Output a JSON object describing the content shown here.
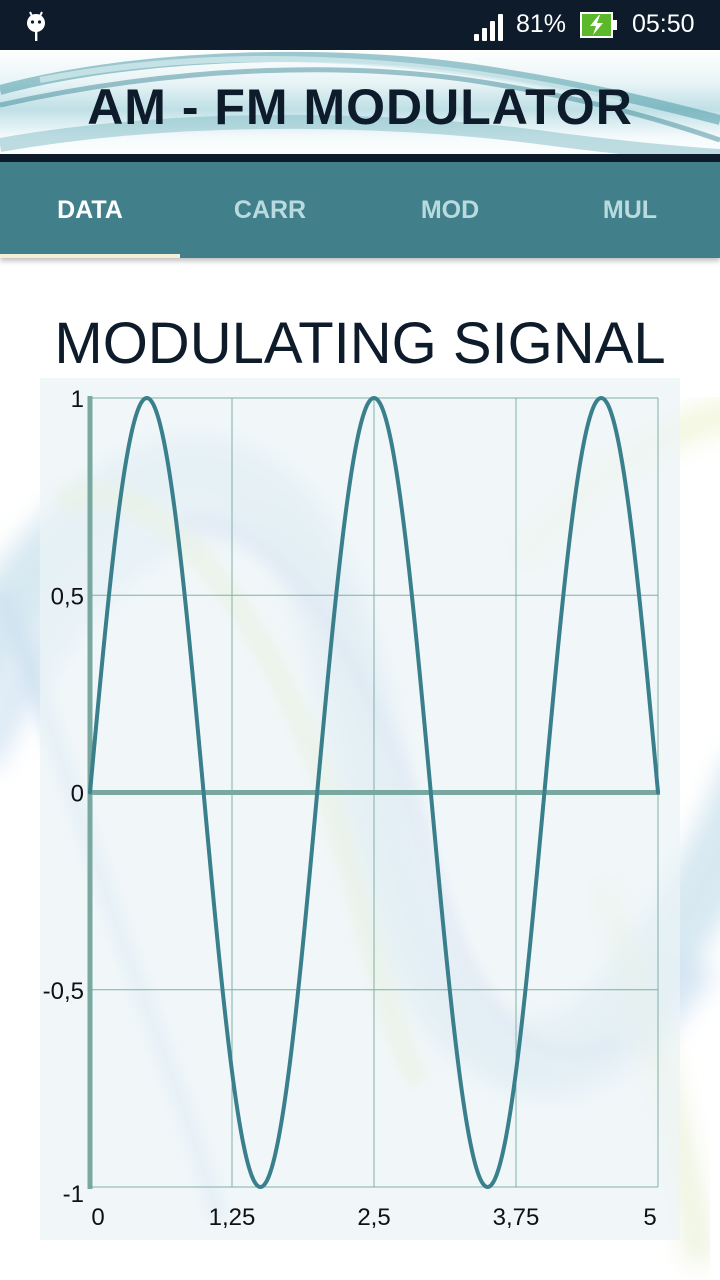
{
  "status_bar": {
    "notification_icon": "android-debug-icon",
    "signal_icon": "cell-signal-icon",
    "battery_percent": "81%",
    "battery_icon": "battery-charging-icon",
    "time": "05:50"
  },
  "banner": {
    "title": "AM - FM MODULATOR"
  },
  "tabs": [
    {
      "label": "DATA",
      "active": true
    },
    {
      "label": "CARR",
      "active": false
    },
    {
      "label": "MOD",
      "active": false
    },
    {
      "label": "MUL",
      "active": false
    }
  ],
  "colors": {
    "accent": "#41808b",
    "status_bar": "#0d1b2a",
    "tab_indicator": "#f4efd6",
    "series_line": "#3a7f8c",
    "axis": "#78a8a0",
    "grid": "#7fb0a8"
  },
  "chart_data": {
    "type": "line",
    "title": "MODULATING SIGNAL",
    "xlabel": "",
    "ylabel": "",
    "xlim": [
      0,
      5
    ],
    "ylim": [
      -1,
      1
    ],
    "x_ticks": [
      0,
      1.25,
      2.5,
      3.75,
      5
    ],
    "x_tick_labels": [
      "0",
      "1,25",
      "2,5",
      "3,75",
      "5"
    ],
    "y_ticks": [
      1,
      0.5,
      0,
      -0.5,
      -1
    ],
    "y_tick_labels": [
      "1",
      "0,5",
      "0",
      "-0,5",
      "-1"
    ],
    "grid": true,
    "legend": "none",
    "series": [
      {
        "name": "modulating signal",
        "function": "sin(2*pi*f*t)",
        "amplitude": 1,
        "frequency": 0.5,
        "x": [
          0,
          0.25,
          0.5,
          0.75,
          1,
          1.25,
          1.5,
          1.75,
          2,
          2.25,
          2.5,
          2.75,
          3,
          3.25,
          3.5,
          3.75,
          4,
          4.25,
          4.5,
          4.75,
          5
        ],
        "values": [
          0,
          0.707,
          1,
          0.707,
          0,
          -0.707,
          -1,
          -0.707,
          0,
          0.707,
          1,
          0.707,
          0,
          -0.707,
          -1,
          -0.707,
          0,
          0.707,
          1,
          0.707,
          0
        ]
      }
    ]
  }
}
